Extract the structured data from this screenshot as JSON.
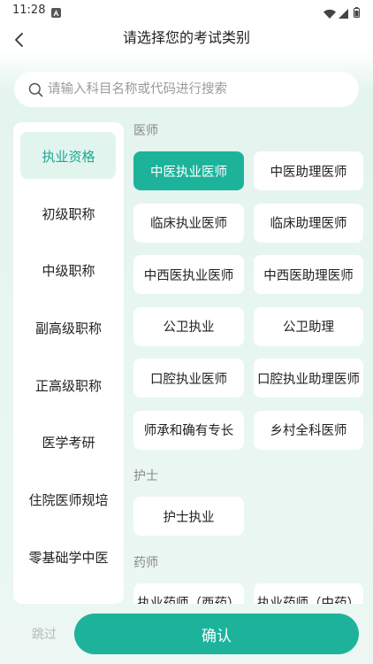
{
  "status_bar": {
    "time": "11:28",
    "icons": [
      "notification-app-icon",
      "wifi-icon",
      "signal-icon",
      "battery-icon"
    ]
  },
  "header": {
    "title": "请选择您的考试类别",
    "back_icon": "chevron-left-icon"
  },
  "search": {
    "placeholder": "请输入科目名称或代码进行搜索",
    "icon": "search-icon"
  },
  "sidebar": {
    "items": [
      {
        "label": "执业资格",
        "selected": true
      },
      {
        "label": "初级职称",
        "selected": false
      },
      {
        "label": "中级职称",
        "selected": false
      },
      {
        "label": "副高级职称",
        "selected": false
      },
      {
        "label": "正高级职称",
        "selected": false
      },
      {
        "label": "医学考研",
        "selected": false
      },
      {
        "label": "住院医师规培",
        "selected": false
      },
      {
        "label": "零基础学中医",
        "selected": false
      }
    ]
  },
  "content": {
    "sections": [
      {
        "title": "医师",
        "items": [
          {
            "label": "中医执业医师",
            "selected": true
          },
          {
            "label": "中医助理医师",
            "selected": false
          },
          {
            "label": "临床执业医师",
            "selected": false
          },
          {
            "label": "临床助理医师",
            "selected": false
          },
          {
            "label": "中西医执业医师",
            "selected": false
          },
          {
            "label": "中西医助理医师",
            "selected": false
          },
          {
            "label": "公卫执业",
            "selected": false
          },
          {
            "label": "公卫助理",
            "selected": false
          },
          {
            "label": "口腔执业医师",
            "selected": false
          },
          {
            "label": "口腔执业助理医师",
            "selected": false
          },
          {
            "label": "师承和确有专长",
            "selected": false
          },
          {
            "label": "乡村全科医师",
            "selected": false
          }
        ]
      },
      {
        "title": "护士",
        "items": [
          {
            "label": "护士执业",
            "selected": false
          }
        ]
      },
      {
        "title": "药师",
        "items": [
          {
            "label": "执业药师（西药）",
            "selected": false
          },
          {
            "label": "执业药师（中药）",
            "selected": false
          }
        ]
      }
    ]
  },
  "footer": {
    "skip_label": "跳过",
    "confirm_label": "确认"
  },
  "colors": {
    "accent": "#1db39b",
    "accent_text": "#1aa993",
    "selected_side_bg": "#e2f4ee",
    "page_background": "#e8f6f1"
  }
}
